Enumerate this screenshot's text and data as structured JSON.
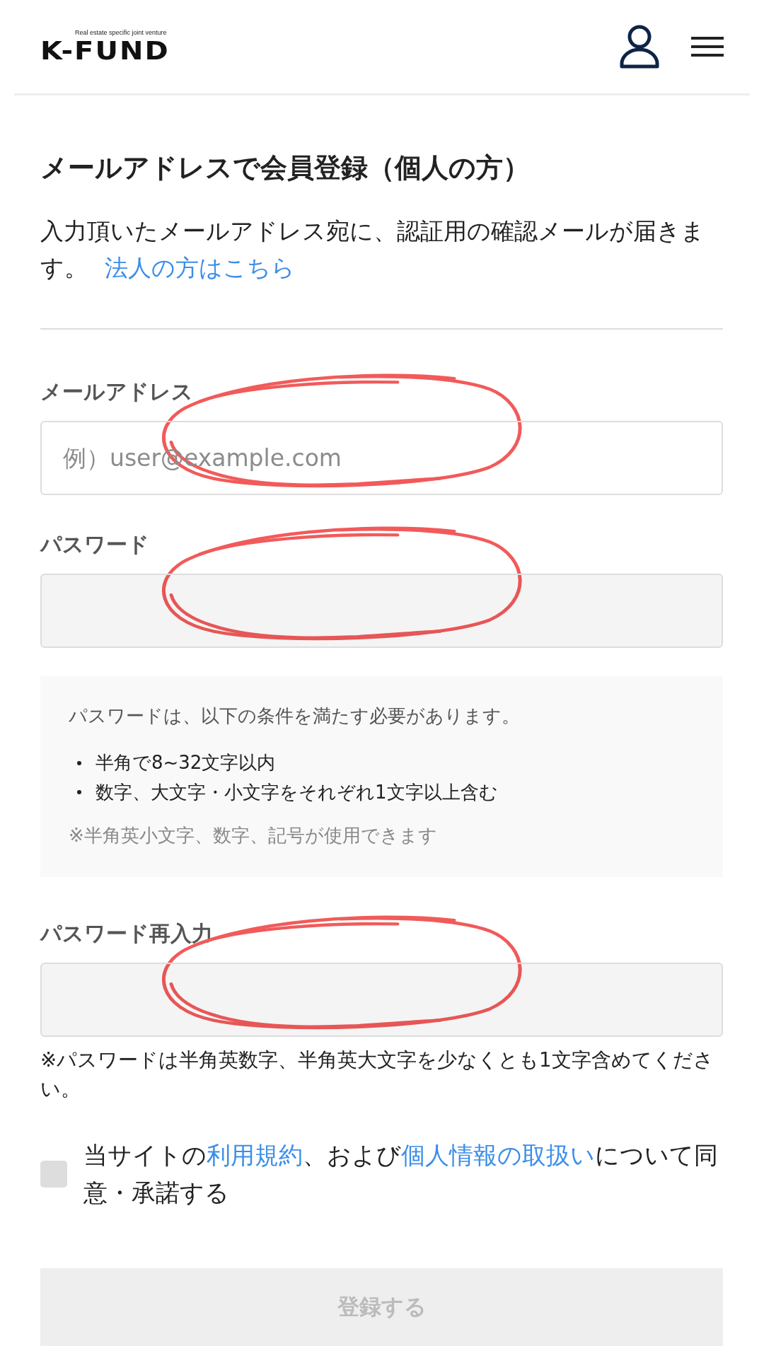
{
  "header": {
    "logo": "K-FUND",
    "tagline": "Real estate specific joint venture"
  },
  "title": "メールアドレスで会員登録（個人の方）",
  "intro": {
    "text": "入力頂いたメールアドレス宛に、認証用の確認メールが届きます。",
    "link": "法人の方はこちら"
  },
  "fields": [
    {
      "label": "メールアドレス",
      "kind": "email",
      "placeholder": "例）user@example.com",
      "circled": true
    },
    {
      "label": "パスワード",
      "kind": "password",
      "circled": true
    },
    {
      "label": "パスワード再入力",
      "kind": "password",
      "circled": true
    }
  ],
  "rules": {
    "heading": "パスワードは、以下の条件を満たす必要があります。",
    "items": [
      "半角で8~32文字以内",
      "数字、大文字・小文字をそれぞれ1文字以上含む"
    ],
    "footnote": "※半角英小文字、数字、記号が使用できます"
  },
  "note": "※パスワードは半角英数字、半角英大文字を少なくとも1文字含めてください。",
  "consent": {
    "checked": false,
    "parts": [
      {
        "kind": "text",
        "text": "当サイトの"
      },
      {
        "kind": "link",
        "text": "利用規約"
      },
      {
        "kind": "text",
        "text": "、および"
      },
      {
        "kind": "link",
        "text": "個人情報の取扱い"
      },
      {
        "kind": "text",
        "text": "について同意・承諾する"
      }
    ]
  },
  "submit": {
    "label": "登録する",
    "disabled": true
  }
}
